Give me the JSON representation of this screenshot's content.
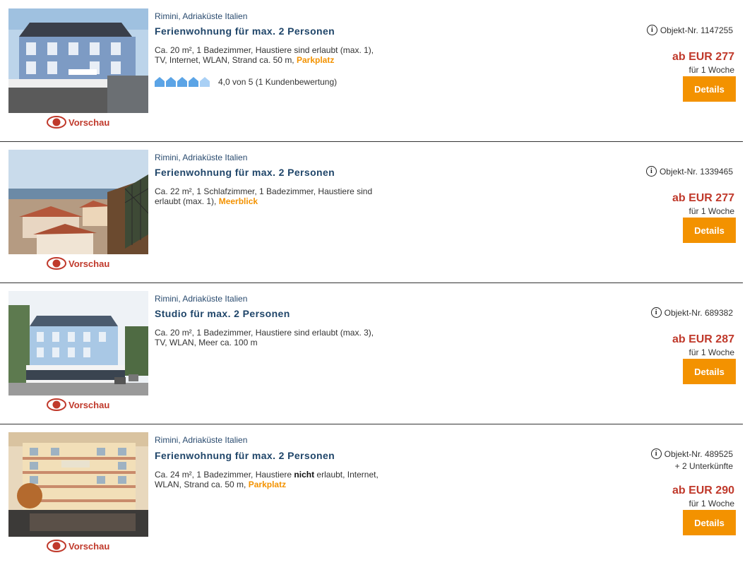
{
  "colors": {
    "accent": "#f39200",
    "price": "#c0392b",
    "title": "#1f4569",
    "rating": "#5ba4e6"
  },
  "listings": [
    {
      "location": "Rimini, Adriaküste Italien",
      "title": "Ferienwohnung für max. 2 Personen",
      "desc_main": "Ca. 20 m², 1 Badezimmer, Haustiere sind erlaubt (max. 1), TV, Internet, WLAN, Strand ca. 50 m, ",
      "desc_highlight": "Parkplatz",
      "rating_value": 4.0,
      "rating_max": 5,
      "rating_text": "4,0 von 5 (1 Kundenbewertung)",
      "object_nr": "Objekt-Nr. 1147255",
      "price": "ab EUR 277",
      "per": "für 1 Woche",
      "details": "Details",
      "preview": "Vorschau",
      "image": "building-photo"
    },
    {
      "location": "Rimini, Adriaküste Italien",
      "title": "Ferienwohnung für max. 2 Personen",
      "desc_main": "Ca. 22 m², 1 Schlafzimmer, 1 Badezimmer, Haustiere sind erlaubt (max. 1), ",
      "desc_highlight": "Meerblick",
      "object_nr": "Objekt-Nr. 1339465",
      "price": "ab EUR 277",
      "per": "für 1 Woche",
      "details": "Details",
      "preview": "Vorschau",
      "image": "sea-view-photo"
    },
    {
      "location": "Rimini, Adriaküste Italien",
      "title": "Studio für max. 2 Personen",
      "desc_main": "Ca. 20 m², 1 Badezimmer, Haustiere sind erlaubt (max. 3), TV, WLAN, Meer ca. 100 m",
      "object_nr": "Objekt-Nr. 689382",
      "price": "ab EUR 287",
      "per": "für 1 Woche",
      "details": "Details",
      "preview": "Vorschau",
      "image": "building-photo"
    },
    {
      "location": "Rimini, Adriaküste Italien",
      "title": "Ferienwohnung für max. 2 Personen",
      "desc_pre": "Ca. 24 m², 1 Badezimmer, Haustiere ",
      "desc_bold": "nicht",
      "desc_post": " erlaubt, Internet, WLAN, Strand ca. 50 m, ",
      "desc_highlight": "Parkplatz",
      "object_nr": "Objekt-Nr. 489525",
      "extra": "+ 2 Unterkünfte",
      "price": "ab EUR 290",
      "per": "für 1 Woche",
      "details": "Details",
      "preview": "Vorschau",
      "image": "hotel-photo"
    }
  ]
}
